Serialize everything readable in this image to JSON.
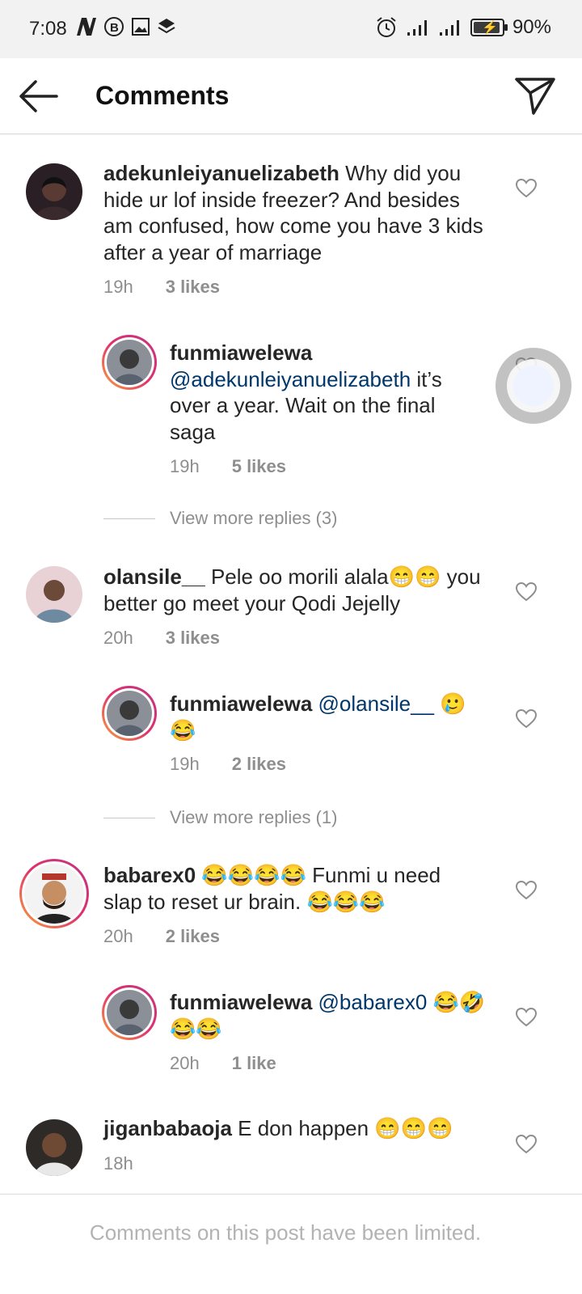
{
  "status_bar": {
    "time": "7:08",
    "battery": "90%",
    "left_icons": [
      "n-notification-icon",
      "b-circle-icon",
      "image-icon",
      "layers-icon"
    ],
    "right_icons": [
      "alarm-icon",
      "signal-icon",
      "signal-icon",
      "battery-icon"
    ]
  },
  "header": {
    "title": "Comments",
    "back_icon": "back-arrow-icon",
    "send_icon": "paper-plane-icon"
  },
  "comments": [
    {
      "username": "adekunleiyanuelizabeth",
      "text": "Why did you hide ur lof inside freezer? And besides am confused, how come you have 3 kids after a year of marriage",
      "time": "19h",
      "likes": "3 likes"
    },
    {
      "username": "funmiawelewa",
      "mention": "@adekunleiyanuelizabeth",
      "text": "it’s over a year. Wait on the final saga",
      "time": "19h",
      "likes": "5 likes"
    },
    {
      "more_replies": "View more replies (3)"
    },
    {
      "username": "olansile__",
      "text": "Pele oo morili alala😁😁 you better go meet your Qodi Jejelly",
      "time": "20h",
      "likes": "3 likes"
    },
    {
      "username": "funmiawelewa",
      "mention": "@olansile__",
      "text": "🥲😂",
      "time": "19h",
      "likes": "2 likes"
    },
    {
      "more_replies": "View more replies (1)"
    },
    {
      "username": "babarex0",
      "text": "😂😂😂😂 Funmi u need slap to reset ur brain. 😂😂😂",
      "time": "20h",
      "likes": "2 likes"
    },
    {
      "username": "funmiawelewa",
      "mention": "@babarex0",
      "text": "😂🤣😂😂",
      "time": "20h",
      "likes": "1 like"
    },
    {
      "username": "jiganbabaoja",
      "text": "E don happen 😁😁😁",
      "time": "18h",
      "likes": ""
    }
  ],
  "footer": {
    "text": "Comments on this post have been limited."
  },
  "colors": {
    "mention": "#00376b",
    "muted": "#8e8e8e",
    "story_ring_start": "#f9a33b",
    "story_ring_end": "#c13584"
  }
}
